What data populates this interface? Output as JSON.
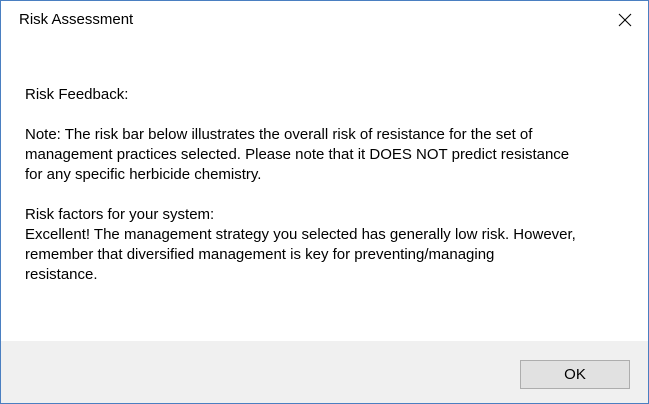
{
  "window": {
    "title": "Risk Assessment",
    "close_icon": "close-icon"
  },
  "message": {
    "heading": "Risk Feedback:",
    "note": "Note: The risk bar below illustrates the overall risk of resistance for the set of\nmanagement practices selected. Please note that it DOES NOT predict resistance\nfor any specific herbicide chemistry.",
    "factors_heading": "Risk factors for your system:",
    "factors_text": "Excellent! The management strategy you selected has generally low risk. However,\nremember that diversified management is key for preventing/managing\nresistance."
  },
  "footer": {
    "ok_label": "OK"
  },
  "colors": {
    "window_border": "#4a7fc1",
    "footer_bg": "#f0f0f0",
    "button_bg": "#e1e1e1",
    "button_border": "#adadad"
  }
}
